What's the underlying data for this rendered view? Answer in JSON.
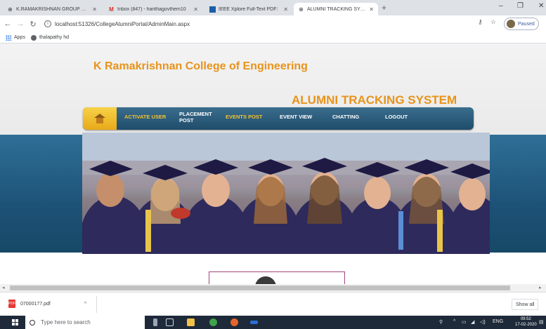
{
  "browser": {
    "tabs": [
      {
        "label": "K.RAMAKRISHNAN GROUP OF I",
        "icon": "globe-icon"
      },
      {
        "label": "Inbox (847) - harithagovthem10",
        "icon": "gmail-icon"
      },
      {
        "label": "IEEE Xplore Full-Text PDF:",
        "icon": "ieee-icon"
      },
      {
        "label": "ALUMNI TRACKING SYSTEM",
        "icon": "globe-icon"
      }
    ],
    "url": "localhost:51326/CollegeAlumniPortal/AdminMain.aspx",
    "profile_status": "Paused",
    "bookmarks": [
      {
        "label": "Apps"
      },
      {
        "label": "thalapathy hd"
      }
    ]
  },
  "site": {
    "college_name": "K Ramakrishnan College of Engineering",
    "system_name": "ALUMNI TRACKING SYSTEM",
    "nav": [
      {
        "label": "ACTIVATE USER",
        "highlight": true
      },
      {
        "label": "PLACEMENT POST",
        "highlight": false
      },
      {
        "label": "EVENTS POST",
        "highlight": true
      },
      {
        "label": "EVENT VIEW",
        "highlight": false
      },
      {
        "label": "CHATTING",
        "highlight": false
      },
      {
        "label": "LOGOUT",
        "highlight": false
      }
    ],
    "colors": {
      "accent": "#e8931a",
      "nav_highlight": "#f6c22c",
      "band": "#1d5277"
    }
  },
  "downloads": {
    "file": "07000177.pdf",
    "show_all": "Show all"
  },
  "taskbar": {
    "search_placeholder": "Type here to search",
    "language": "ENG",
    "time": "09:52",
    "date": "17-02-2020"
  }
}
